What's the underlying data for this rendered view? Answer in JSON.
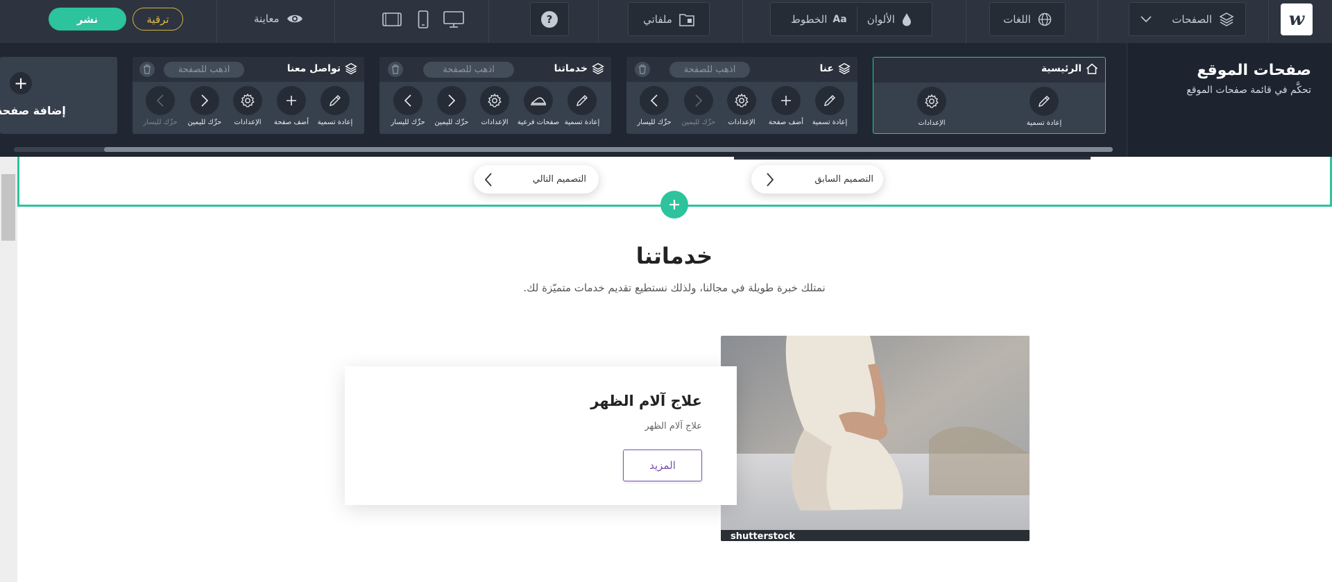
{
  "toolbar": {
    "publish_label": "نشر",
    "upgrade_label": "ترقية",
    "preview_label": "معاينة",
    "help_label": "?",
    "files_label": "ملفاتي",
    "fonts_label": "الخطوط",
    "fonts_glyph": "Aa",
    "colors_label": "الألوان",
    "languages_label": "اللغات",
    "pages_label": "الصفحات",
    "logo_glyph": "w"
  },
  "panel": {
    "title": "صفحات الموقع",
    "subtitle": "تحكَّم في قائمة صفحات الموقع",
    "add_page_label": "إضافة صفحة",
    "go_to_page": "اذهب للصفحة",
    "pages": [
      {
        "title": "الرئيسية",
        "actions": [
          "إعادة تسمية",
          "الإعدادات"
        ]
      },
      {
        "title": "عنا",
        "actions": [
          "إعادة تسمية",
          "أضف صفحة",
          "الإعدادات",
          "حرِّك لليمين",
          "حرِّك لليسار"
        ]
      },
      {
        "title": "خدماتنا",
        "actions": [
          "إعادة تسمية",
          "صفحات فرعية",
          "الإعدادات",
          "حرِّك لليمين",
          "حرِّك لليسار"
        ]
      },
      {
        "title": "تواصل معنا",
        "actions": [
          "إعادة تسمية",
          "أضف صفحة",
          "الإعدادات",
          "حرِّك لليمين",
          "حرِّك لليسار"
        ]
      }
    ]
  },
  "canvas": {
    "prev_design": "التصميم السابق",
    "next_design": "التصميم التالي",
    "section_title": "خدماتنا",
    "section_subtitle": "نمتلك خبرة طويلة في مجالنا، ولذلك نستطيع تقديم خدمات متميّزة لك.",
    "service": {
      "title": "علاج آلام الظهر",
      "description": "علاج آلام الظهر",
      "more_label": "المزيد",
      "image_watermark": "shutterstock"
    }
  },
  "colors": {
    "accent": "#2dc39c",
    "toolbar_bg": "#2d3440",
    "panel_bg": "#202732",
    "upgrade": "#e0bd47",
    "more_button": "#7a4fb0"
  }
}
